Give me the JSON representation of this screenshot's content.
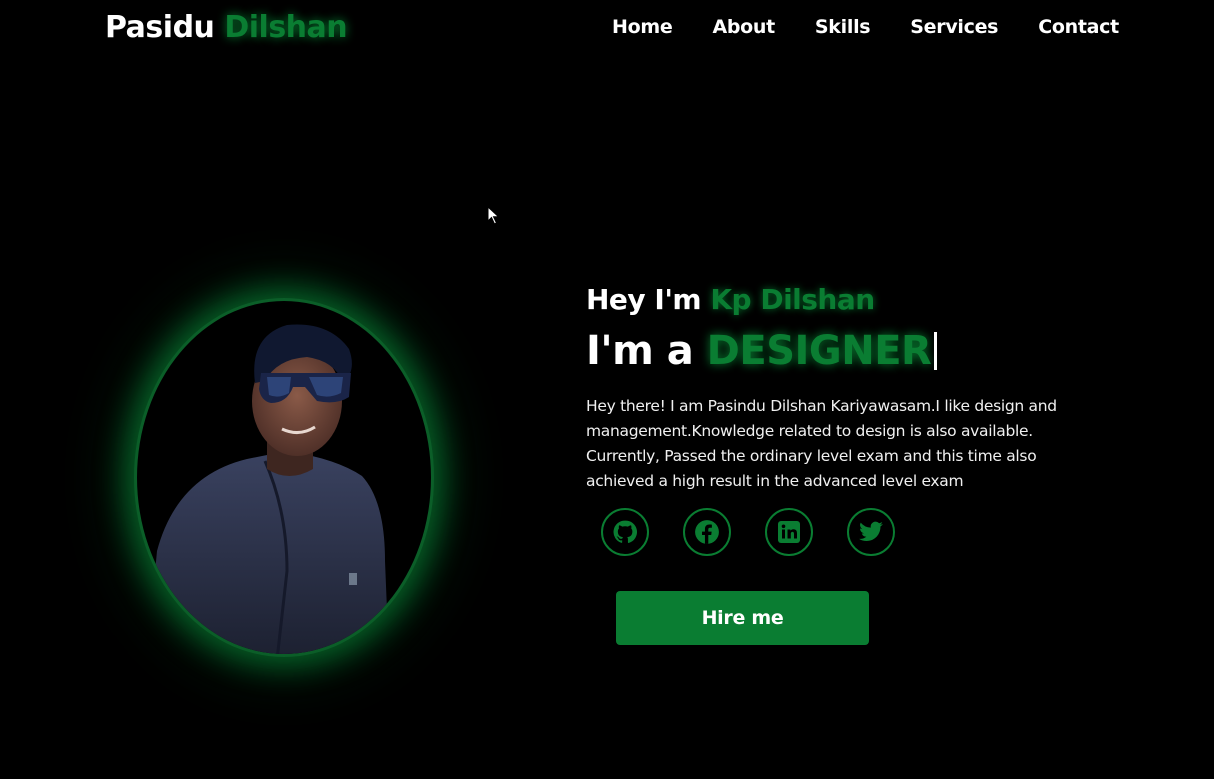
{
  "header": {
    "logo_first": "Pasidu",
    "logo_accent": "Dilshan",
    "nav": [
      "Home",
      "About",
      "Skills",
      "Services",
      "Contact"
    ]
  },
  "hero": {
    "greeting_prefix": "Hey I'm",
    "greeting_name": "Kp Dilshan",
    "role_prefix": "I'm a",
    "role_word": "DESIGNER",
    "bio": "Hey there! I am Pasindu Dilshan Kariyawasam.I like design and management.Knowledge related to design is also available. Currently, Passed the ordinary level exam and this time also achieved a high result in the advanced level exam",
    "hire_label": "Hire me"
  },
  "social": [
    "github-icon",
    "facebook-icon",
    "linkedin-icon",
    "twitter-icon"
  ],
  "colors": {
    "accent": "#0a7d32",
    "background": "#000000",
    "text": "#ffffff"
  }
}
